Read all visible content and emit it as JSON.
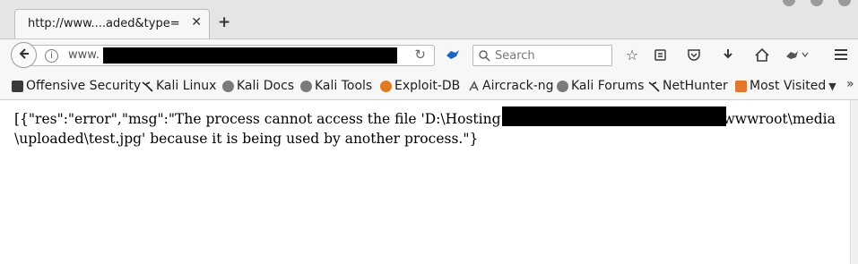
{
  "tab": {
    "title": "http://www....aded&type=",
    "close": "✕",
    "new_tab": "+"
  },
  "navbar": {
    "url_prefix": "www.",
    "search_placeholder": "Search"
  },
  "bookmarks": [
    {
      "label": "Offensive Security",
      "icon": "offsec-icon",
      "color": "#3a3a3a"
    },
    {
      "label": "Kali Linux",
      "icon": "kali-dragon-icon",
      "color": "#222222"
    },
    {
      "label": "Kali Docs",
      "icon": "globe-icon",
      "color": "#7a7a7a"
    },
    {
      "label": "Kali Tools",
      "icon": "globe-icon",
      "color": "#7a7a7a"
    },
    {
      "label": "Exploit-DB",
      "icon": "exploitdb-icon",
      "color": "#e07a1f"
    },
    {
      "label": "Aircrack-ng",
      "icon": "aircrack-icon",
      "color": "#555555"
    },
    {
      "label": "Kali Forums",
      "icon": "globe-icon",
      "color": "#7a7a7a"
    },
    {
      "label": "NetHunter",
      "icon": "kali-dragon-icon",
      "color": "#222222"
    },
    {
      "label": "Most Visited",
      "icon": "most-visited-icon",
      "color": "#e2762a"
    }
  ],
  "content": {
    "line1_start": "[{\"res\":\"error\",\"msg\":\"The process cannot access the file 'D:\\Hosting",
    "line1_end": "wwwroot\\media",
    "line2": "\\uploaded\\test.jpg' because it is being used by another process.\"}"
  }
}
